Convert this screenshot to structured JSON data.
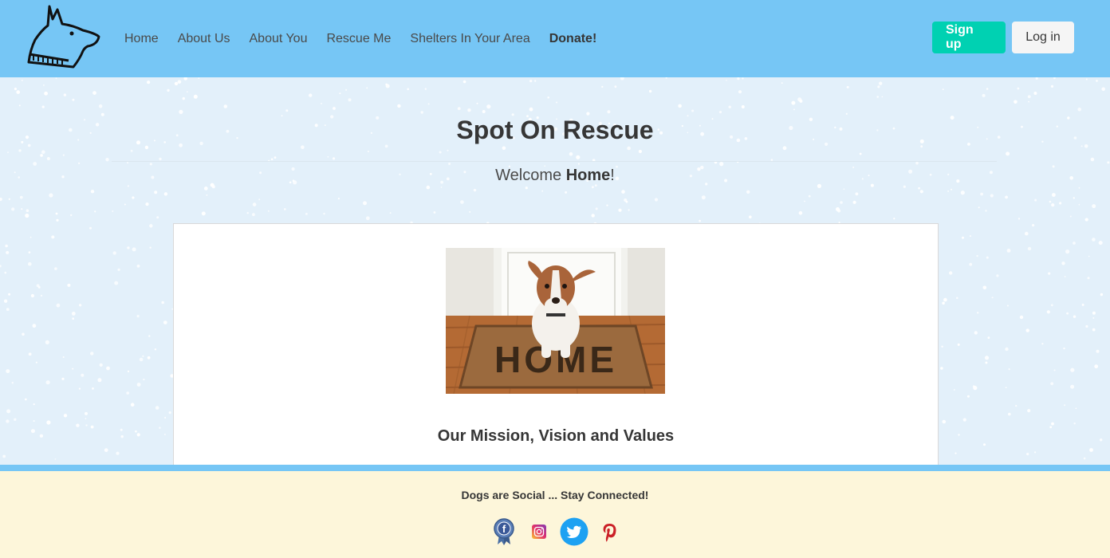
{
  "nav": {
    "logo": "dog-logo-icon",
    "links": [
      "Home",
      "About Us",
      "About You",
      "Rescue Me",
      "Shelters In Your Area",
      "Donate!"
    ],
    "signup_label": "Sign up",
    "login_label": "Log in"
  },
  "hero": {
    "title": "Spot On Rescue",
    "welcome_prefix": "Welcome ",
    "welcome_bold": "Home",
    "welcome_suffix": "!"
  },
  "card": {
    "image": "dog-on-home-doormat",
    "mat_text": "HOME",
    "heading": "Our Mission, Vision and Values"
  },
  "footer": {
    "text_prefix": "Dogs are ",
    "text_bold": "Social",
    "text_suffix": " ... Stay Connected!",
    "icons": [
      "facebook-icon",
      "instagram-icon",
      "twitter-icon",
      "pinterest-icon"
    ]
  },
  "colors": {
    "navbar": "#76c6f5",
    "signup": "#00d1b2",
    "background": "#e3f0fa",
    "footer": "#fdf6da"
  }
}
